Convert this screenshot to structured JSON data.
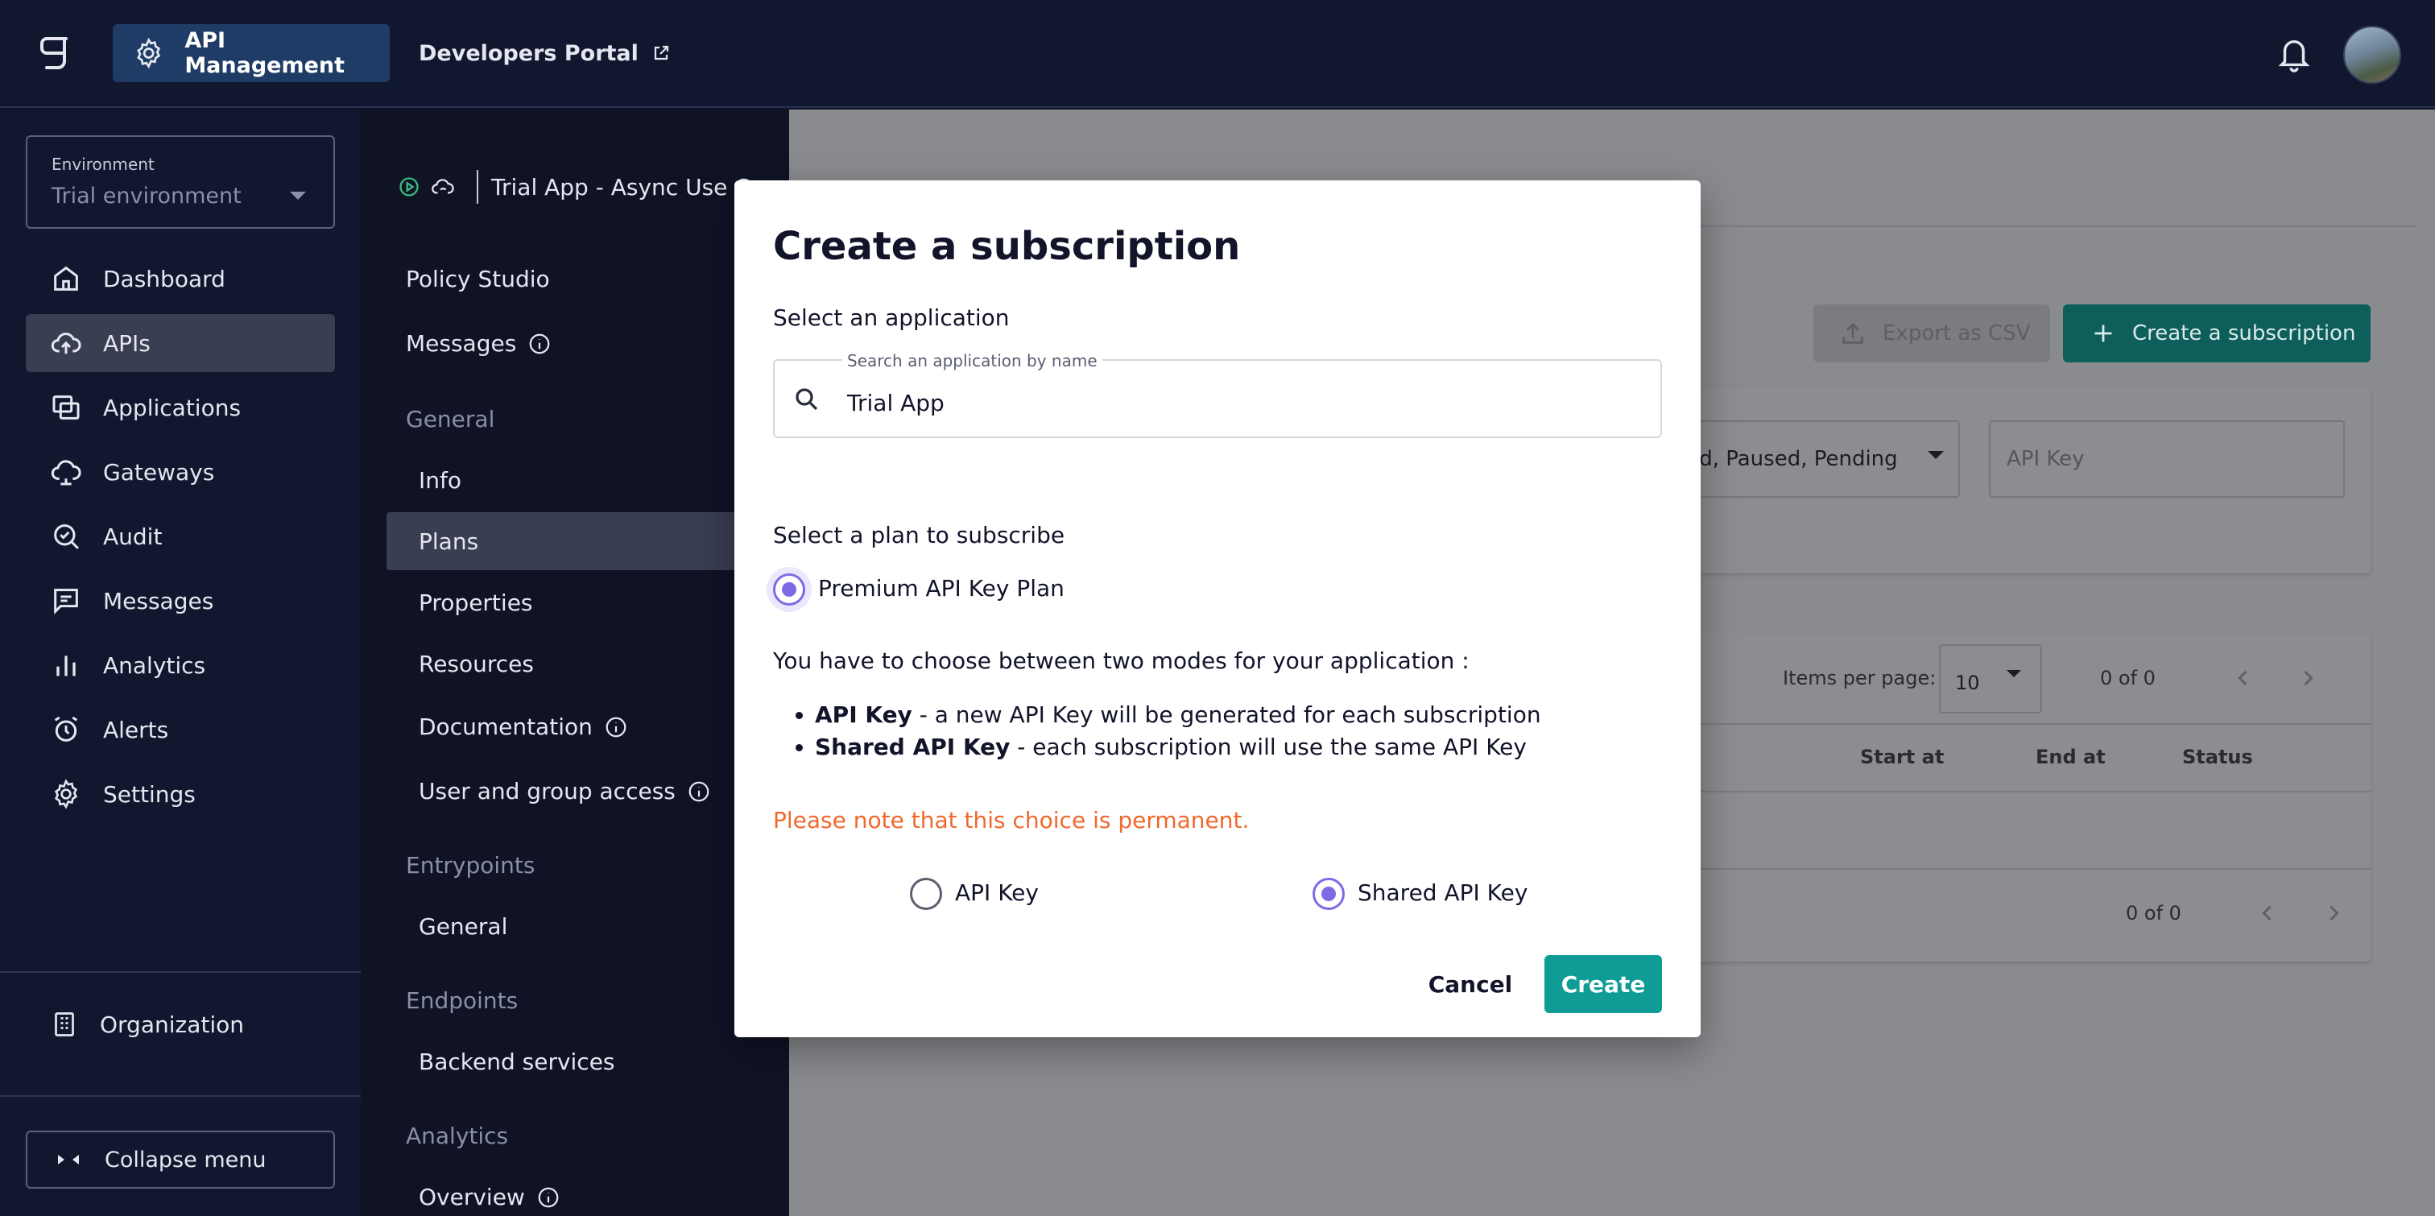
{
  "topbar": {
    "app_button": "API Management",
    "dev_portal": "Developers Portal"
  },
  "sidebar": {
    "environment_label": "Environment",
    "environment_value": "Trial environment",
    "items": [
      {
        "label": "Dashboard",
        "icon": "home-icon"
      },
      {
        "label": "APIs",
        "icon": "cloud-upload-icon",
        "active": true
      },
      {
        "label": "Applications",
        "icon": "applications-icon"
      },
      {
        "label": "Gateways",
        "icon": "gateway-icon"
      },
      {
        "label": "Audit",
        "icon": "audit-icon"
      },
      {
        "label": "Messages",
        "icon": "messages-icon"
      },
      {
        "label": "Analytics",
        "icon": "analytics-icon"
      },
      {
        "label": "Alerts",
        "icon": "alarm-icon"
      },
      {
        "label": "Settings",
        "icon": "gear-icon"
      }
    ],
    "organization": "Organization",
    "collapse": "Collapse menu"
  },
  "api_menu": {
    "api_name": "Trial App - Async Use C",
    "policy_studio": "Policy Studio",
    "messages": "Messages",
    "general_section": "General",
    "info": "Info",
    "plans": "Plans",
    "properties": "Properties",
    "resources": "Resources",
    "documentation": "Documentation",
    "user_group_access": "User and group access",
    "entrypoints_section": "Entrypoints",
    "entrypoints_general": "General",
    "endpoints_section": "Endpoints",
    "backend_services": "Backend services",
    "analytics_section": "Analytics",
    "overview": "Overview"
  },
  "content": {
    "export_csv": "Export as CSV",
    "create_subscription": "Create a subscription",
    "status_filter": "ted, Paused, Pending",
    "api_key_placeholder": "API Key",
    "items_per_page_label": "Items per page:",
    "items_per_page_value": "10",
    "range_top": "0 of 0",
    "range_bottom": "0 of 0",
    "columns": [
      "Start at",
      "End at",
      "Status"
    ]
  },
  "modal": {
    "title": "Create a subscription",
    "select_application": "Select an application",
    "search_label": "Search an application by name",
    "search_value": "Trial App",
    "select_plan": "Select a plan to subscribe",
    "plan_option": "Premium API Key Plan",
    "choose_mode": "You have to choose between two modes for your application :",
    "bullet1_bold": "API Key",
    "bullet1_rest": " - a new API Key will be generated for each subscription",
    "bullet2_bold": "Shared API Key",
    "bullet2_rest": " - each subscription will use the same API Key",
    "note": "Please note that this choice is permanent.",
    "option_api_key": "API Key",
    "option_shared": "Shared API Key",
    "selected_option": "Shared API Key",
    "cancel": "Cancel",
    "create": "Create"
  },
  "colors": {
    "topbar_bg": "#121730",
    "accent_teal": "#0f9c97",
    "radio_purple": "#7d6be6",
    "warning_orange": "#f0692d"
  }
}
